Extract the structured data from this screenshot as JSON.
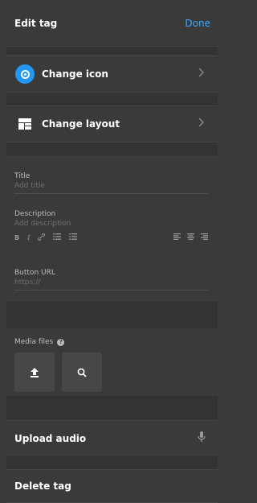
{
  "header": {
    "title": "Edit tag",
    "done_label": "Done"
  },
  "rows": {
    "change_icon": {
      "label": "Change icon",
      "icon": "circle-target-icon",
      "chevron": "chevron-right-icon"
    },
    "change_layout": {
      "label": "Change layout",
      "icon": "layout-grid-icon",
      "chevron": "chevron-right-icon"
    }
  },
  "form": {
    "title": {
      "label": "Title",
      "placeholder": "Add title"
    },
    "description": {
      "label": "Description",
      "placeholder": "Add description"
    },
    "toolbar": {
      "bold": "B",
      "italic": "I",
      "link_icon": "link-icon",
      "ordered_list_icon": "ordered-list-icon",
      "bullet_list_icon": "bullet-list-icon",
      "align_left_icon": "align-left-icon",
      "align_center_icon": "align-center-icon",
      "align_right_icon": "align-right-icon"
    },
    "button_url": {
      "label": "Button URL",
      "placeholder": "https://"
    }
  },
  "media": {
    "label": "Media files",
    "help_icon": "help-icon",
    "upload_icon": "upload-icon",
    "search_icon": "search-icon"
  },
  "upload_audio": {
    "label": "Upload audio",
    "icon": "microphone-icon"
  },
  "delete_tag": {
    "label": "Delete tag"
  },
  "colors": {
    "accent": "#3ea6ff",
    "primary_button": "#2196f3",
    "background": "#3a3a3a"
  }
}
